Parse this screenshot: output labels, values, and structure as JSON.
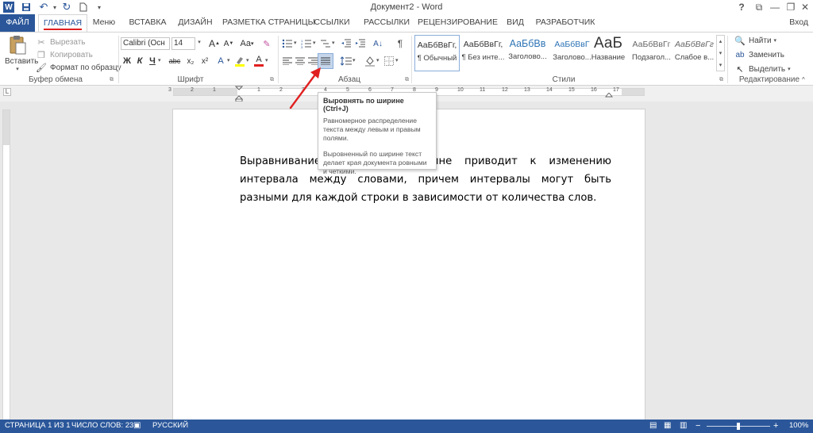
{
  "window": {
    "title": "Документ2 - Word"
  },
  "qat": {
    "icons": [
      "word-logo-icon",
      "save-icon",
      "undo-icon",
      "redo-icon",
      "new-document-icon",
      "customize-qat-icon"
    ]
  },
  "window_controls": {
    "help": "?",
    "ribbon_options": "⧉",
    "minimize": "—",
    "restore": "❐",
    "close": "✕"
  },
  "login": "Вход",
  "tabs": [
    {
      "label": "ФАЙЛ"
    },
    {
      "label": "ГЛАВНАЯ"
    },
    {
      "label": "Меню"
    },
    {
      "label": "ВСТАВКА"
    },
    {
      "label": "ДИЗАЙН"
    },
    {
      "label": "РАЗМЕТКА СТРАНИЦЫ"
    },
    {
      "label": "ССЫЛКИ"
    },
    {
      "label": "РАССЫЛКИ"
    },
    {
      "label": "РЕЦЕНЗИРОВАНИЕ"
    },
    {
      "label": "ВИД"
    },
    {
      "label": "РАЗРАБОТЧИК"
    }
  ],
  "clipboard": {
    "label": "Буфер обмена",
    "paste": "Вставить",
    "cut": "Вырезать",
    "copy": "Копировать",
    "format_painter": "Формат по образцу"
  },
  "font": {
    "label": "Шрифт",
    "name": "Calibri (Осн",
    "size": "14",
    "grow": "A",
    "shrink": "A",
    "case": "Aa",
    "bold": "Ж",
    "italic": "К",
    "underline": "Ч",
    "strike": "abc",
    "subscript": "x₂",
    "superscript": "x²",
    "highlight_color": "#ffff00",
    "font_color": "#e02020"
  },
  "paragraph": {
    "label": "Абзац"
  },
  "styles": {
    "label": "Стили",
    "items": [
      {
        "sample": "АаБбВвГг,",
        "name": "¶ Обычный"
      },
      {
        "sample": "АаБбВвГг,",
        "name": "¶ Без инте..."
      },
      {
        "sample": "АаБбВв",
        "name": "Заголово..."
      },
      {
        "sample": "АаБбВвГ",
        "name": "Заголово..."
      },
      {
        "sample": "АаБ",
        "name": "Название"
      },
      {
        "sample": "АаБбВвГг",
        "name": "Подзагол..."
      },
      {
        "sample": "АаБбВвГг",
        "name": "Слабое в..."
      }
    ]
  },
  "editing": {
    "label": "Редактирование",
    "find": "Найти",
    "replace": "Заменить",
    "select": "Выделить"
  },
  "ruler": {
    "labels": [
      "3",
      "2",
      "1",
      "1",
      "2",
      "3",
      "4",
      "5",
      "6",
      "7",
      "8",
      "9",
      "10",
      "11",
      "12",
      "13",
      "14",
      "15",
      "16",
      "17"
    ]
  },
  "tooltip": {
    "title": "Выровнять по ширине (Ctrl+J)",
    "p1": "Равномерное распределение текста между левым и правым полями.",
    "p2": "Выровненный по ширине текст делает края документа ровными и четкими."
  },
  "document": {
    "paragraph": "Выравнивание текста по ширине приводит к изменению интервала между словами, причем интервалы могут быть разными для каждой строки в зависимости от количества слов."
  },
  "status": {
    "page": "СТРАНИЦА 1 ИЗ 1",
    "words": "ЧИСЛО СЛОВ: 23",
    "language": "РУССКИЙ",
    "zoom": "100%"
  },
  "colors": {
    "accent": "#2b579a",
    "annotation": "#e02020"
  }
}
